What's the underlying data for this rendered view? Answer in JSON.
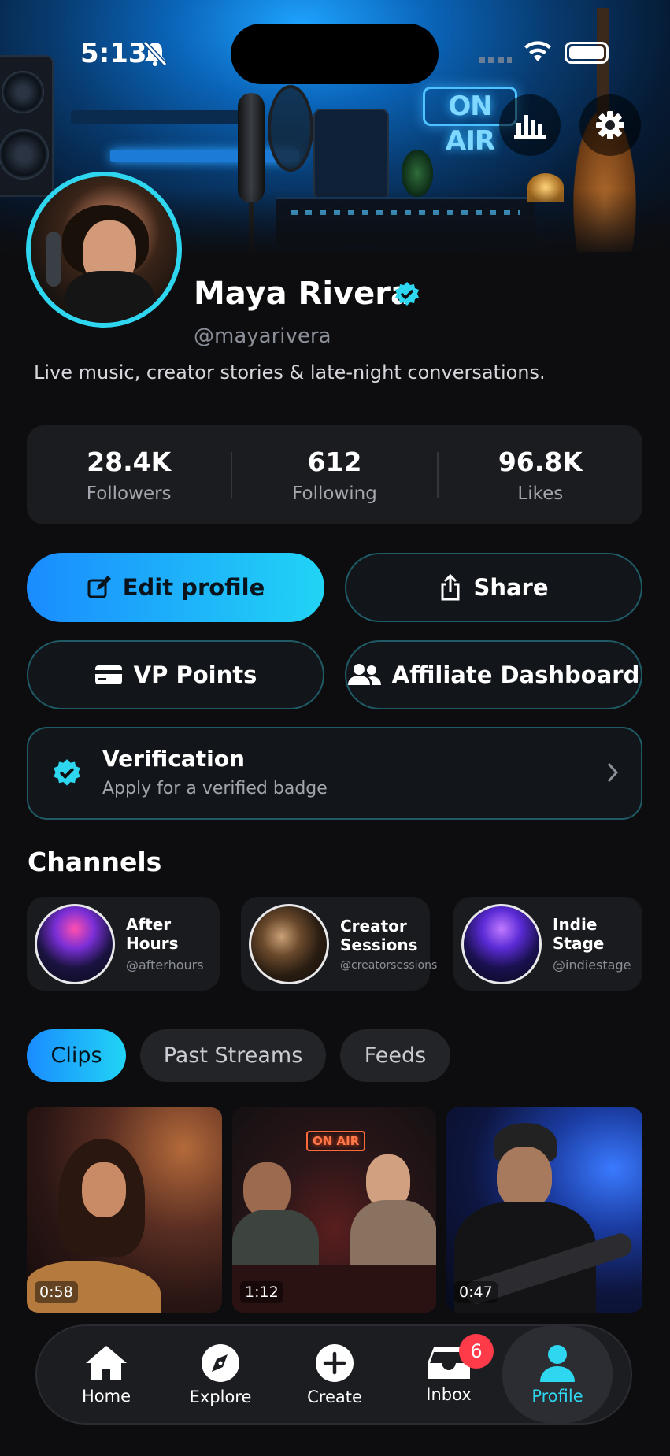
{
  "status": {
    "time": "5:13"
  },
  "header": {
    "on_air": "ON AIR"
  },
  "profile": {
    "name": "Maya Rivera",
    "handle": "@mayarivera",
    "bio": "Live music, creator stories & late-night conversations."
  },
  "stats": [
    {
      "value": "28.4K",
      "label": "Followers"
    },
    {
      "value": "612",
      "label": "Following"
    },
    {
      "value": "96.8K",
      "label": "Likes"
    }
  ],
  "actions": {
    "edit": "Edit profile",
    "share": "Share",
    "vp": "VP Points",
    "affiliate": "Affiliate Dashboard"
  },
  "verification": {
    "title": "Verification",
    "subtitle": "Apply for a verified badge"
  },
  "channels": {
    "heading": "Channels",
    "items": [
      {
        "title": "After Hours",
        "handle": "@afterhours"
      },
      {
        "title": "Creator Sessions",
        "handle": "@creatorsessions"
      },
      {
        "title": "Indie Stage",
        "handle": "@indiestage"
      }
    ]
  },
  "tabs": [
    "Clips",
    "Past Streams",
    "Feeds"
  ],
  "clips": [
    {
      "duration": "0:58"
    },
    {
      "duration": "1:12",
      "sign": "ON AIR"
    },
    {
      "duration": "0:47"
    }
  ],
  "nav": {
    "items": [
      "Home",
      "Explore",
      "Create",
      "Inbox",
      "Profile"
    ],
    "inbox_badge": "6",
    "active": "Profile"
  },
  "colors": {
    "accent": "#2fd6f0",
    "primary_gradient_start": "#1a8cff",
    "primary_gradient_end": "#21d4f5",
    "badge": "#ff3b4a",
    "background": "#0d0d0f"
  }
}
